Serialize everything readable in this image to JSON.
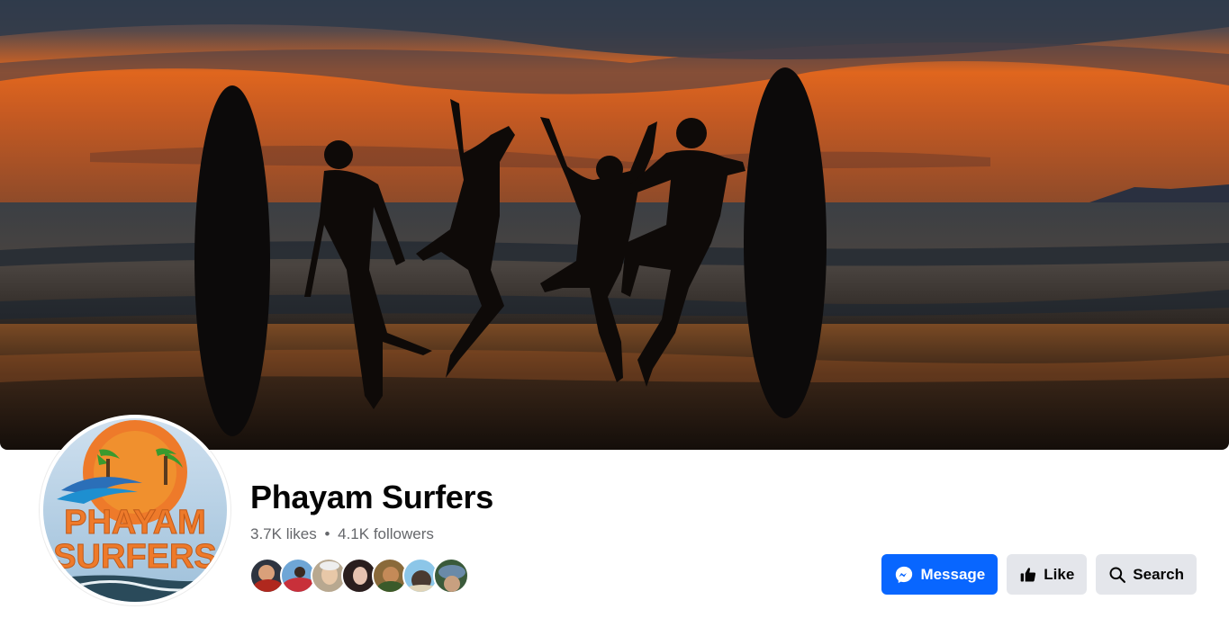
{
  "page": {
    "name": "Phayam Surfers",
    "likes": "3.7K likes",
    "separator": "•",
    "followers": "4.1K followers"
  },
  "cover_photo": {
    "description_icon": "beach-sunset-surfers-photo"
  },
  "profile_picture": {
    "logo_line1": "PHAYAM",
    "logo_line2": "SURFERS"
  },
  "friends": [
    {
      "icon": "friend-avatar-1"
    },
    {
      "icon": "friend-avatar-2"
    },
    {
      "icon": "friend-avatar-3"
    },
    {
      "icon": "friend-avatar-4"
    },
    {
      "icon": "friend-avatar-5"
    },
    {
      "icon": "friend-avatar-6"
    },
    {
      "icon": "friend-avatar-7"
    }
  ],
  "actions": {
    "message_label": "Message",
    "like_label": "Like",
    "search_label": "Search"
  },
  "colors": {
    "primary_button": "#0866ff",
    "secondary_button": "#e4e6eb",
    "title_text": "#050505",
    "meta_text": "#65676b"
  }
}
